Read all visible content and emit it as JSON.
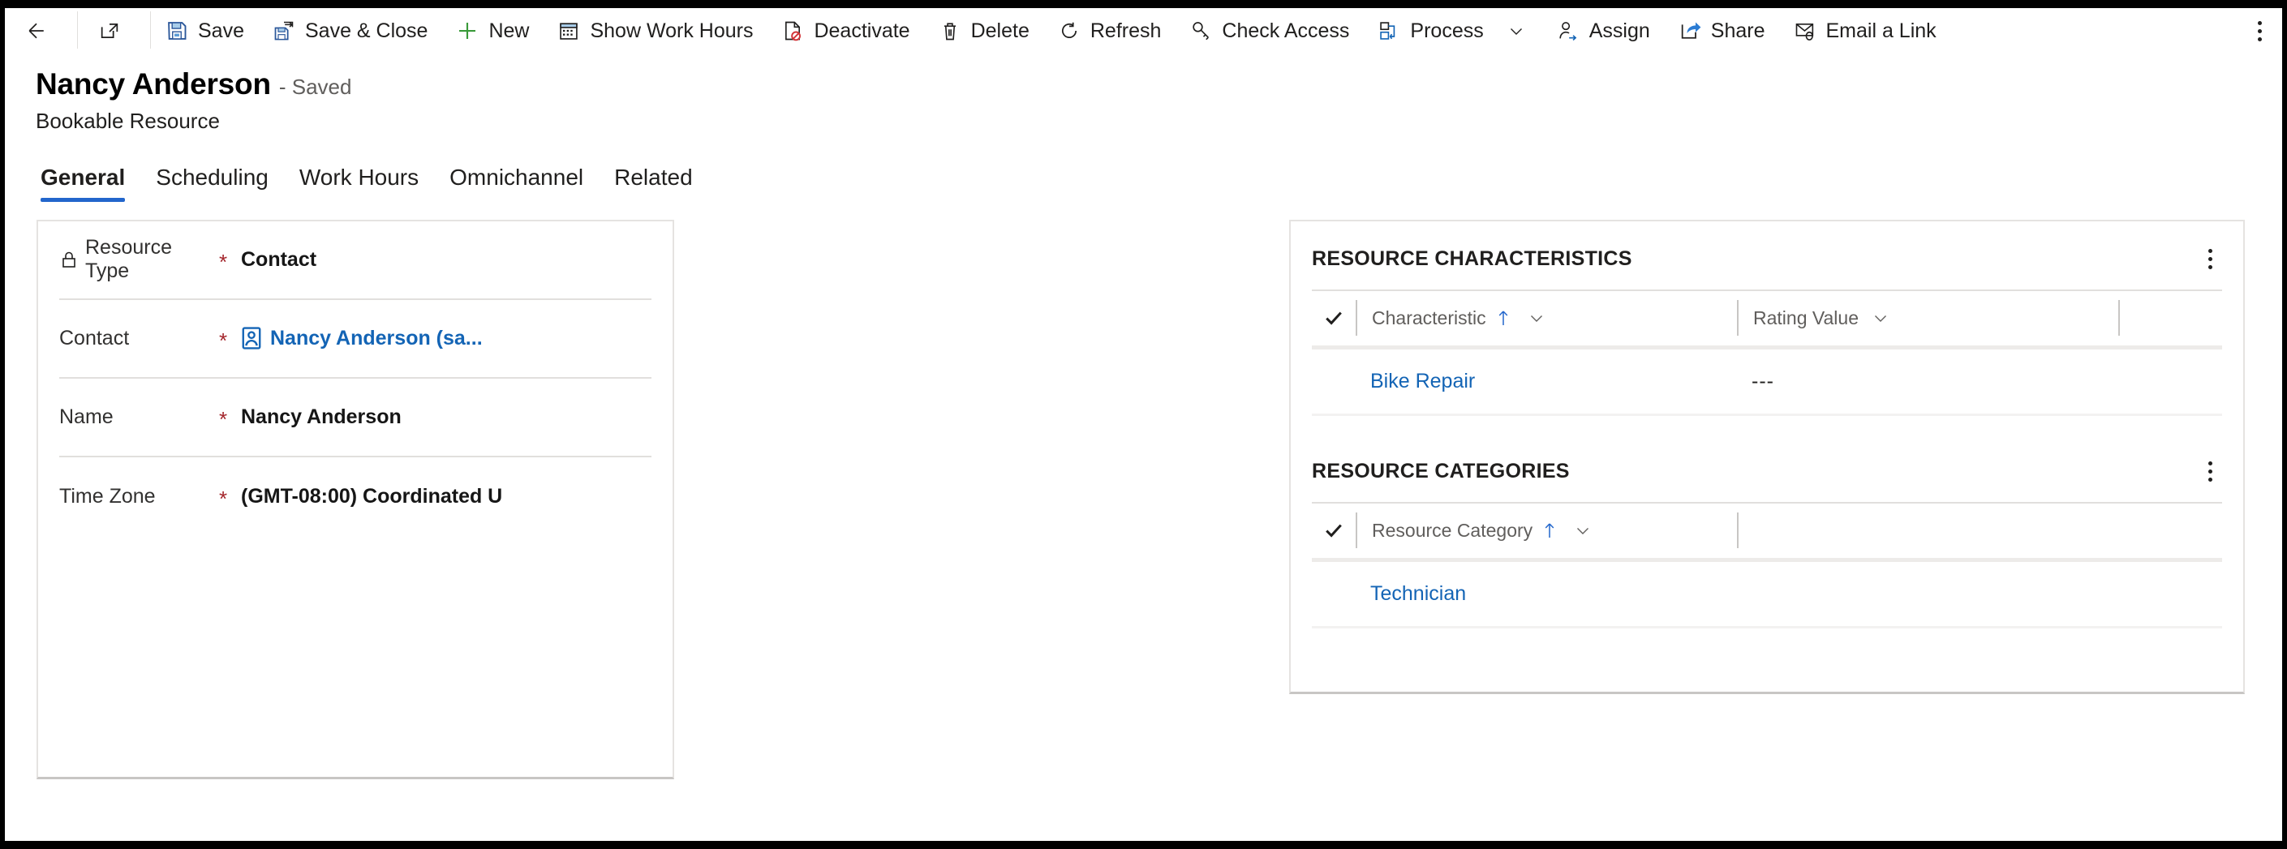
{
  "commandbar": {
    "buttons": [
      {
        "name": "back",
        "icon": "back-arrow-icon",
        "label": ""
      },
      {
        "name": "popout",
        "icon": "pop-out-icon",
        "label": ""
      },
      {
        "name": "save",
        "icon": "save-icon",
        "label": "Save"
      },
      {
        "name": "save-and-close",
        "icon": "save-close-icon",
        "label": "Save & Close"
      },
      {
        "name": "new",
        "icon": "plus-icon",
        "label": "New"
      },
      {
        "name": "show-work-hours",
        "icon": "calendar-icon",
        "label": "Show Work Hours"
      },
      {
        "name": "deactivate",
        "icon": "deactivate-icon",
        "label": "Deactivate"
      },
      {
        "name": "delete",
        "icon": "trash-icon",
        "label": "Delete"
      },
      {
        "name": "refresh",
        "icon": "refresh-icon",
        "label": "Refresh"
      },
      {
        "name": "check-access",
        "icon": "key-icon",
        "label": "Check Access"
      },
      {
        "name": "process",
        "icon": "process-icon",
        "label": "Process",
        "chevron": true
      },
      {
        "name": "assign",
        "icon": "assign-person-icon",
        "label": "Assign"
      },
      {
        "name": "share",
        "icon": "share-icon",
        "label": "Share"
      },
      {
        "name": "email-a-link",
        "icon": "email-link-icon",
        "label": "Email a Link"
      }
    ],
    "overflow_icon": "more-vertical-icon"
  },
  "header": {
    "title": "Nancy Anderson",
    "state": "- Saved",
    "subtitle": "Bookable Resource"
  },
  "tabs": [
    {
      "label": "General",
      "active": true
    },
    {
      "label": "Scheduling",
      "active": false
    },
    {
      "label": "Work Hours",
      "active": false
    },
    {
      "label": "Omnichannel",
      "active": false
    },
    {
      "label": "Related",
      "active": false
    }
  ],
  "form": {
    "fields": [
      {
        "label": "Resource Type",
        "required": "*",
        "value": "Contact",
        "locked": true,
        "link": false
      },
      {
        "label": "Contact",
        "required": "*",
        "value": "Nancy Anderson (sa...",
        "locked": false,
        "link": true
      },
      {
        "label": "Name",
        "required": "*",
        "value": "Nancy Anderson",
        "locked": false,
        "link": false
      },
      {
        "label": "Time Zone",
        "required": "*",
        "value": "(GMT-08:00) Coordinated U",
        "locked": false,
        "link": false
      }
    ]
  },
  "panels": [
    {
      "title": "RESOURCE CHARACTERISTICS",
      "columns": [
        "Characteristic",
        "Rating Value"
      ],
      "sorted_column": "Characteristic",
      "sort_direction": "asc",
      "rows": [
        {
          "characteristic": "Bike Repair",
          "rating_value": "---"
        }
      ]
    },
    {
      "title": "RESOURCE CATEGORIES",
      "columns": [
        "Resource Category"
      ],
      "sorted_column": "Resource Category",
      "sort_direction": "asc",
      "rows": [
        {
          "resource_category": "Technician"
        }
      ]
    }
  ],
  "colors": {
    "link": "#1364b5",
    "required": "#a4262c",
    "tab_accent": "#2266cc",
    "sort_arrow": "#2266cc"
  }
}
